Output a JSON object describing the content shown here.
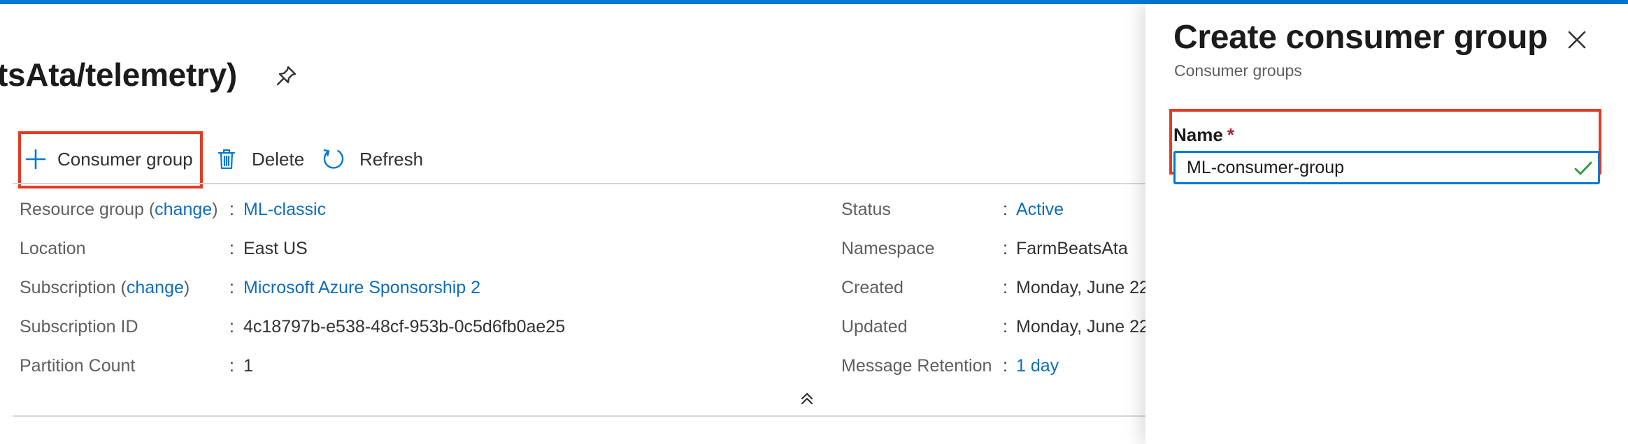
{
  "header": {
    "title": "tsAta/telemetry)"
  },
  "toolbar": {
    "consumer_group_label": "Consumer group",
    "delete_label": "Delete",
    "refresh_label": "Refresh"
  },
  "essentials": {
    "left": {
      "resource_group": {
        "label_prefix": "Resource group (",
        "change": "change",
        "label_suffix": ")",
        "value": "ML-classic"
      },
      "location": {
        "label": "Location",
        "value": "East US"
      },
      "subscription": {
        "label_prefix": "Subscription (",
        "change": "change",
        "label_suffix": ")",
        "value": "Microsoft Azure Sponsorship 2"
      },
      "subscription_id": {
        "label": "Subscription ID",
        "value": "4c18797b-e538-48cf-953b-0c5d6fb0ae25"
      },
      "partition_count": {
        "label": "Partition Count",
        "value": "1"
      }
    },
    "right": {
      "status": {
        "label": "Status",
        "value": "Active"
      },
      "namespace": {
        "label": "Namespace",
        "value": "FarmBeatsAta"
      },
      "created": {
        "label": "Created",
        "value": "Monday, June 22"
      },
      "updated": {
        "label": "Updated",
        "value": "Monday, June 22"
      },
      "message_retention": {
        "label": "Message Retention",
        "value": "1 day"
      }
    },
    "separator": ":"
  },
  "panel": {
    "title": "Create consumer group",
    "subtitle": "Consumer groups",
    "name_label": "Name",
    "required_marker": "*",
    "name_value": "ML-consumer-group"
  },
  "colors": {
    "accent": "#0078d4",
    "link": "#0f6cbd",
    "highlight": "#e03c26",
    "valid_check": "#2e9e3a"
  },
  "icons": [
    "add-icon",
    "trash-icon",
    "refresh-icon",
    "pin-icon",
    "chevron-double-up-icon",
    "close-icon",
    "checkmark-icon"
  ]
}
